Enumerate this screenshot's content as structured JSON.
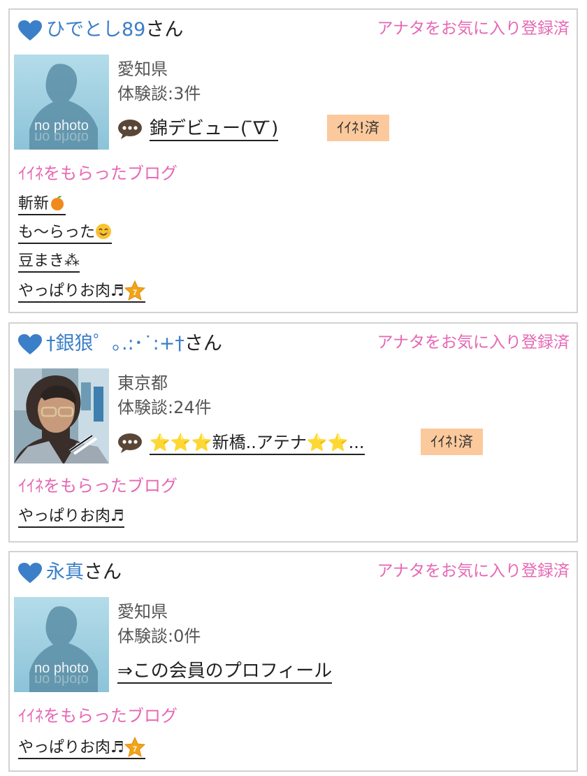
{
  "members": [
    {
      "nickname": "ひでとし89",
      "honorific": "さん",
      "favorite_status": "アナタをお気に入り登録済",
      "avatar": "no-photo",
      "avatar_caption": "no photo",
      "prefecture": "愛知県",
      "review_count": "体験談:3件",
      "latest_post": "錦デビュー( ̄∇ ̄)",
      "iine_badge": "ｲｲﾈ!済",
      "blog_heading": "ｲｲﾈをもらったブログ",
      "liked_blogs": [
        {
          "title": "斬新",
          "emoji": "orange"
        },
        {
          "title": "も〜らった",
          "emoji": "smile"
        },
        {
          "title": "豆まき⁂",
          "emoji": ""
        },
        {
          "title": "やっぱりお肉♬",
          "emoji": "star-badge"
        }
      ]
    },
    {
      "nickname": "†銀狼゜｡.:･˙:+†",
      "honorific": "さん",
      "favorite_status": "アナタをお気に入り登録済",
      "avatar": "photo",
      "prefecture": "東京都",
      "review_count": "体験談:24件",
      "latest_post": "⭐⭐⭐新橋..アテナ⭐⭐...",
      "iine_badge": "ｲｲﾈ!済",
      "blog_heading": "ｲｲﾈをもらったブログ",
      "liked_blogs": [
        {
          "title": "やっぱりお肉♬",
          "emoji": ""
        }
      ]
    },
    {
      "nickname": "永真",
      "honorific": "さん",
      "favorite_status": "アナタをお気に入り登録済",
      "avatar": "no-photo",
      "avatar_caption": "no photo",
      "prefecture": "愛知県",
      "review_count": "体験談:0件",
      "profile_link": "⇒この会員のプロフィール",
      "blog_heading": "ｲｲﾈをもらったブログ",
      "liked_blogs": [
        {
          "title": "やっぱりお肉♬",
          "emoji": "star-badge"
        }
      ]
    }
  ],
  "colors": {
    "nickname": "#3b7fc8",
    "pink_text": "#e667b4",
    "badge_bg": "#fcc99c",
    "card_border": "#d2d2d2"
  }
}
